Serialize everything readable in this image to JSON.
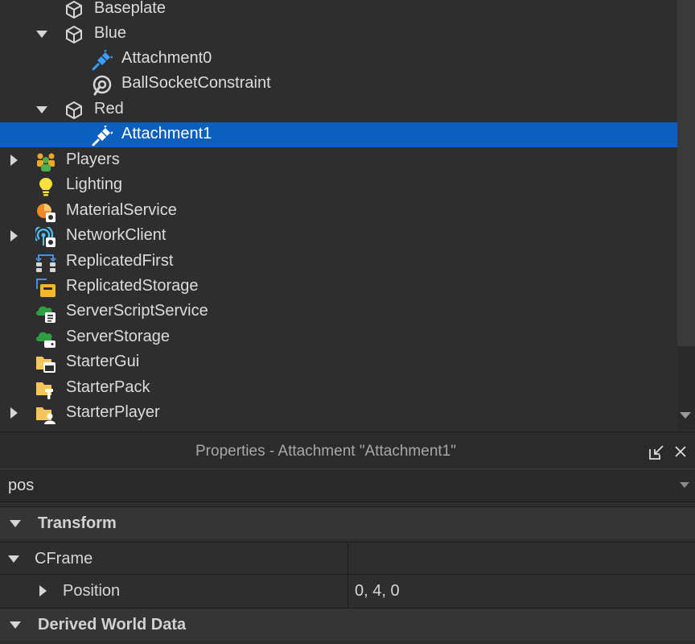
{
  "explorer": {
    "items": [
      {
        "label": "Baseplate",
        "icon": "part-cube-icon"
      },
      {
        "label": "Blue",
        "icon": "model-cube-icon"
      },
      {
        "label": "Attachment0",
        "icon": "attachment-plug-icon"
      },
      {
        "label": "BallSocketConstraint",
        "icon": "ball-socket-icon"
      },
      {
        "label": "Red",
        "icon": "model-cube-icon"
      },
      {
        "label": "Attachment1",
        "icon": "attachment-plug-icon"
      },
      {
        "label": "Players",
        "icon": "players-icon"
      },
      {
        "label": "Lighting",
        "icon": "lighting-bulb-icon"
      },
      {
        "label": "MaterialService",
        "icon": "material-service-icon"
      },
      {
        "label": "NetworkClient",
        "icon": "network-client-icon"
      },
      {
        "label": "ReplicatedFirst",
        "icon": "replicated-first-icon"
      },
      {
        "label": "ReplicatedStorage",
        "icon": "replicated-storage-icon"
      },
      {
        "label": "ServerScriptService",
        "icon": "server-script-service-icon"
      },
      {
        "label": "ServerStorage",
        "icon": "server-storage-icon"
      },
      {
        "label": "StarterGui",
        "icon": "starter-gui-icon"
      },
      {
        "label": "StarterPack",
        "icon": "starter-pack-icon"
      },
      {
        "label": "StarterPlayer",
        "icon": "starter-player-icon"
      }
    ],
    "selected_index": 5
  },
  "properties": {
    "title": "Properties - Attachment \"Attachment1\"",
    "filter_value": "pos",
    "rows": [
      {
        "label": "Transform",
        "value": ""
      },
      {
        "label": "CFrame",
        "value": ""
      },
      {
        "label": "Position",
        "value": "0, 4, 0"
      },
      {
        "label": "Derived World Data",
        "value": ""
      }
    ]
  },
  "colors": {
    "selection": "#0b5fbf",
    "panel_bg": "#2e2e2e",
    "attachment_blue": "#3aa0ff"
  }
}
